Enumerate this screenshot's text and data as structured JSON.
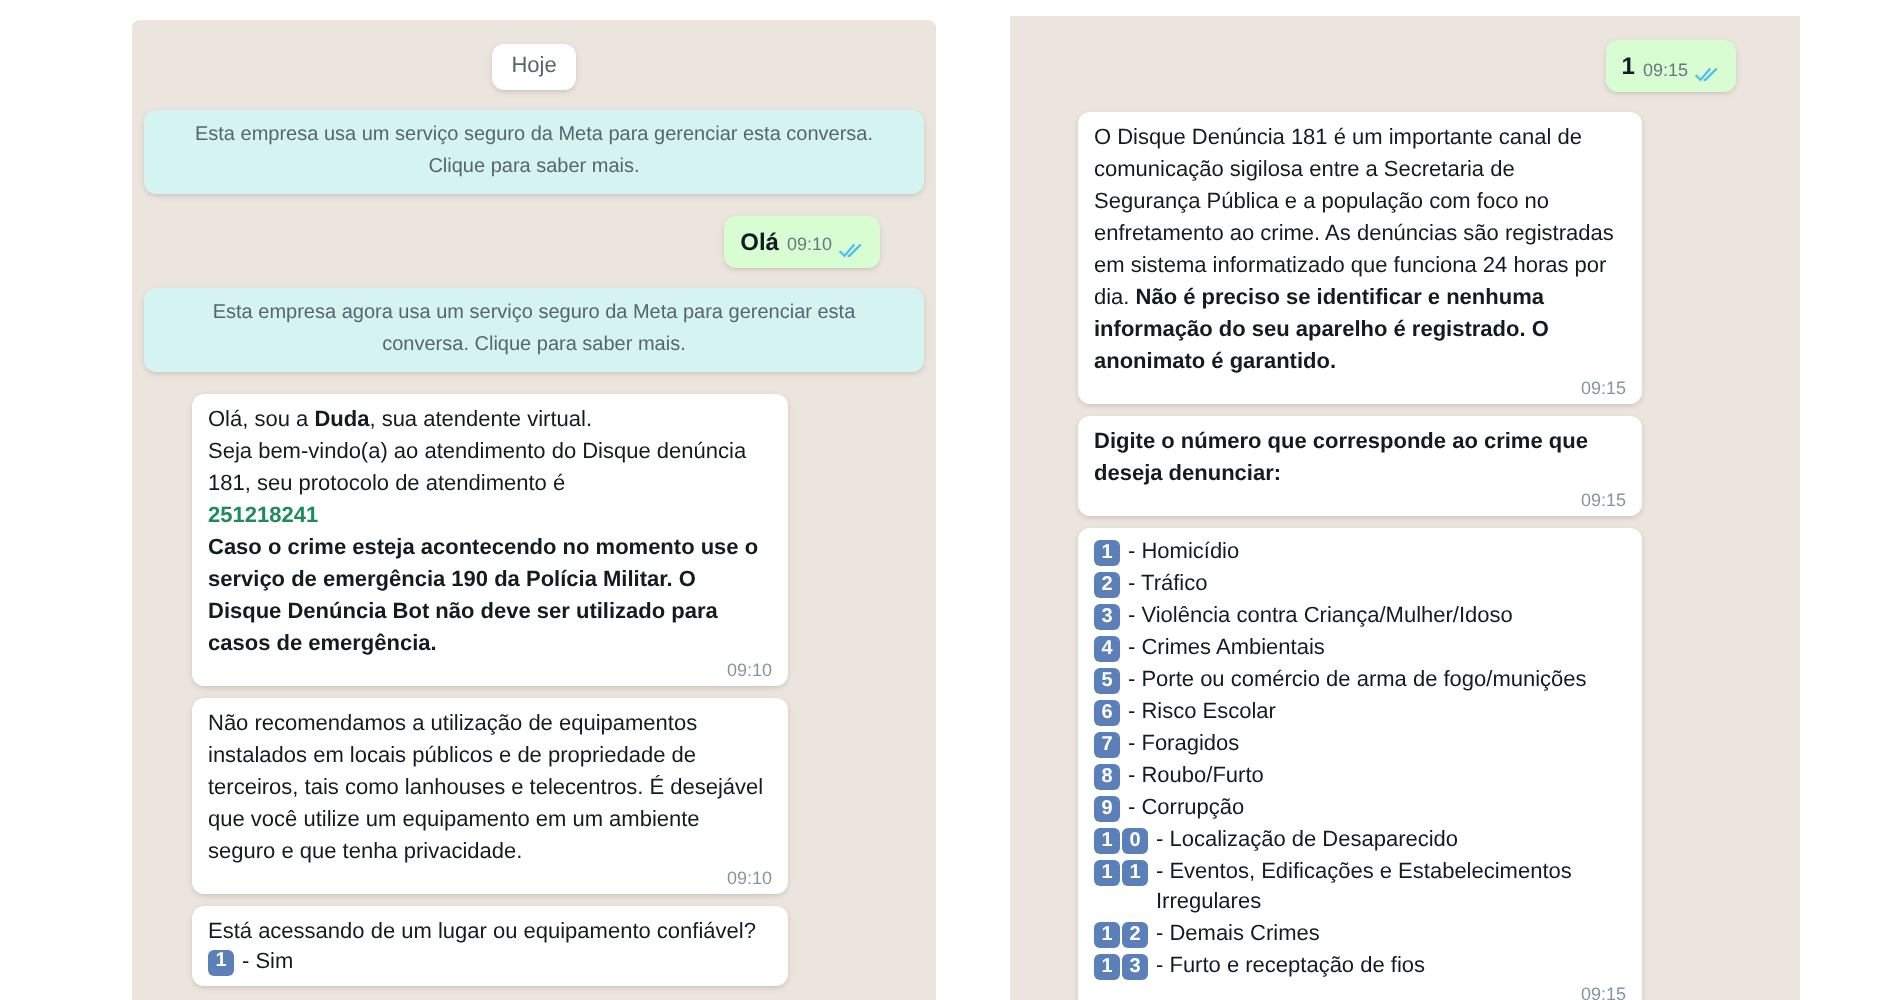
{
  "panels": [
    {
      "messages": [
        {
          "kind": "date",
          "text": "Hoje"
        },
        {
          "kind": "system",
          "text": "Esta empresa usa um serviço seguro da Meta para gerenciar esta conversa. Clique para saber mais."
        },
        {
          "kind": "sent",
          "text": "Olá",
          "time": "09:10",
          "read": true
        },
        {
          "kind": "system",
          "text": "Esta empresa agora usa um serviço seguro da Meta para gerenciar esta conversa. Clique para saber mais."
        },
        {
          "kind": "received",
          "paragraphs": [
            {
              "kind": "plain",
              "text": "Olá, sou a **Duda**, sua atendente virtual."
            },
            {
              "kind": "plain",
              "text": "Seja bem-vindo(a) ao atendimento do Disque denúncia 181, seu protocolo de atendimento é"
            },
            {
              "kind": "protocol",
              "text": "251218241"
            },
            {
              "kind": "bold",
              "text": "Caso o crime esteja acontecendo no momento use o serviço de emergência 190 da Polícia Militar. O Disque Denúncia Bot não deve ser utilizado para casos de emergência."
            }
          ],
          "time": "09:10"
        },
        {
          "kind": "received",
          "paragraphs": [
            {
              "kind": "plain",
              "text": "Não recomendamos a utilização de equipamentos instalados em locais públicos e de propriedade de terceiros, tais como lanhouses e telecentros. É desejável que você utilize um equipamento em um ambiente seguro e que tenha privacidade."
            }
          ],
          "time": "09:10"
        },
        {
          "kind": "received",
          "paragraphs": [
            {
              "kind": "plain",
              "text": "Está acessando de um lugar ou equipamento confiável?"
            }
          ],
          "options": [
            {
              "keys": [
                "1"
              ],
              "label": "- Sim"
            }
          ]
        }
      ]
    },
    {
      "messages": [
        {
          "kind": "sent",
          "text": "1",
          "time": "09:15",
          "read": true
        },
        {
          "kind": "received",
          "paragraphs": [
            {
              "kind": "plain",
              "text": "O Disque Denúncia 181 é um importante canal de comunicação sigilosa entre a Secretaria de Segurança Pública e a população com foco no enfretamento ao crime. As denúncias são registradas em sistema informatizado que funciona 24 horas por dia. **Não é preciso se identificar e nenhuma informação do seu aparelho é registrado. O anonimato é garantido.**"
            }
          ],
          "time": "09:15"
        },
        {
          "kind": "received",
          "paragraphs": [
            {
              "kind": "bold",
              "text": "Digite o número que corresponde ao crime que deseja denunciar:"
            }
          ],
          "time": "09:15"
        },
        {
          "kind": "received",
          "options": [
            {
              "keys": [
                "1"
              ],
              "label": "- Homicídio"
            },
            {
              "keys": [
                "2"
              ],
              "label": "- Tráfico"
            },
            {
              "keys": [
                "3"
              ],
              "label": "- Violência contra Criança/Mulher/Idoso"
            },
            {
              "keys": [
                "4"
              ],
              "label": "- Crimes Ambientais"
            },
            {
              "keys": [
                "5"
              ],
              "label": "- Porte ou comércio de arma de fogo/munições"
            },
            {
              "keys": [
                "6"
              ],
              "label": "- Risco Escolar"
            },
            {
              "keys": [
                "7"
              ],
              "label": "- Foragidos"
            },
            {
              "keys": [
                "8"
              ],
              "label": "- Roubo/Furto"
            },
            {
              "keys": [
                "9"
              ],
              "label": "- Corrupção"
            },
            {
              "keys": [
                "1",
                "0"
              ],
              "label": "- Localização de Desaparecido"
            },
            {
              "keys": [
                "1",
                "1"
              ],
              "label": "- Eventos, Edificações e Estabelecimentos Irregulares"
            },
            {
              "keys": [
                "1",
                "2"
              ],
              "label": "- Demais Crimes"
            },
            {
              "keys": [
                "1",
                "3"
              ],
              "label": "- Furto e receptação de fios"
            }
          ],
          "time": "09:15"
        },
        {
          "kind": "received_stub"
        }
      ]
    }
  ]
}
